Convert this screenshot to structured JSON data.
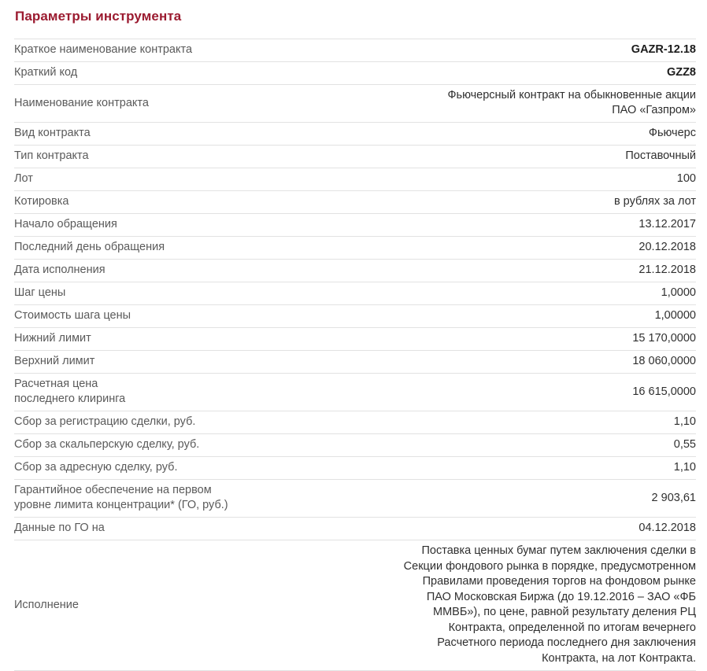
{
  "page": {
    "title": "Параметры инструмента",
    "title_color": "#9b1b30",
    "label_color": "#5a5a5a",
    "value_color": "#2f2f2f",
    "divider_color": "#e2e2e2"
  },
  "rows": [
    {
      "label": "Краткое наименование контракта",
      "value": "GAZR-12.18",
      "bold": true
    },
    {
      "label": "Краткий код",
      "value": "GZZ8",
      "bold": true
    },
    {
      "label": "Наименование контракта",
      "value": "Фьючерсный контракт на обыкновенные акции\nПАО «Газпром»",
      "bold": false
    },
    {
      "label": "Вид контракта",
      "value": "Фьючерс",
      "bold": false
    },
    {
      "label": "Тип контракта",
      "value": "Поставочный",
      "bold": false
    },
    {
      "label": "Лот",
      "value": "100",
      "bold": false
    },
    {
      "label": "Котировка",
      "value": "в рублях за лот",
      "bold": false
    },
    {
      "label": "Начало обращения",
      "value": "13.12.2017",
      "bold": false
    },
    {
      "label": "Последний день обращения",
      "value": "20.12.2018",
      "bold": false
    },
    {
      "label": "Дата исполнения",
      "value": "21.12.2018",
      "bold": false
    },
    {
      "label": "Шаг цены",
      "value": "1,0000",
      "bold": false
    },
    {
      "label": "Стоимость шага цены",
      "value": "1,00000",
      "bold": false
    },
    {
      "label": "Нижний лимит",
      "value": "15 170,0000",
      "bold": false
    },
    {
      "label": "Верхний лимит",
      "value": "18 060,0000",
      "bold": false
    },
    {
      "label": "Расчетная цена\nпоследнего клиринга",
      "value": "16 615,0000",
      "bold": false
    },
    {
      "label": "Сбор за регистрацию сделки, руб.",
      "value": "1,10",
      "bold": false
    },
    {
      "label": "Сбор за скальперскую сделку, руб.",
      "value": "0,55",
      "bold": false
    },
    {
      "label": "Сбор за адресную сделку, руб.",
      "value": "1,10",
      "bold": false
    },
    {
      "label": "Гарантийное обеспечение на первом\nуровне лимита концентрации* (ГО, руб.)",
      "value": "2 903,61",
      "bold": false
    },
    {
      "label": "Данные по ГО на",
      "value": "04.12.2018",
      "bold": false
    },
    {
      "label": "Исполнение",
      "value": "Поставка ценных бумаг путем заключения сделки в\nСекции фондового рынка в порядке, предусмотренном\nПравилами проведения торгов на фондовом рынке\nПАО Московская Биржа (до 19.12.2016 – ЗАО «ФБ\nММВБ»), по цене, равной результату деления РЦ\nКонтракта, определенной по итогам вечернего\nРасчетного периода последнего дня заключения\nКонтракта, на лот Контракта.",
      "bold": false
    }
  ]
}
